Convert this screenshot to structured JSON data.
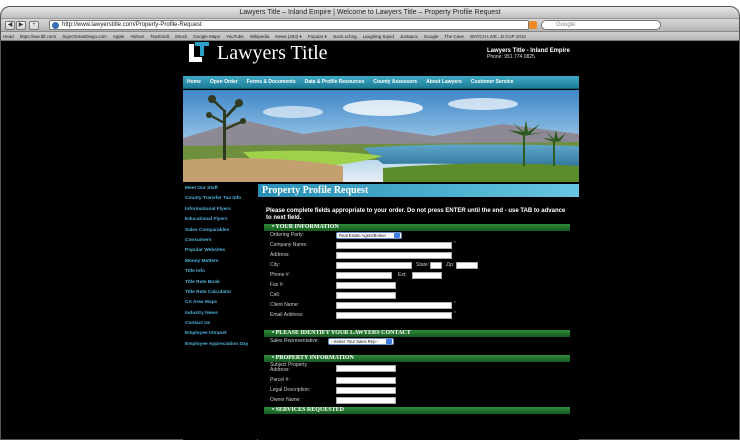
{
  "browser": {
    "window_title": "Lawyers Title – Inland Empire | Welcome to Lawyers Title – Property Profile Request",
    "url": "http://www.lawyerstitle.com/Property-Profile-Request",
    "search_placeholder": "Google",
    "bookmarks": [
      "Head",
      "https://ww.lttl.com/",
      "SignOnSanDiego.com",
      "Apple",
      "Yahoo!",
      "TeaSmidt",
      "iStock",
      "Google Maps",
      "YouTube",
      "Wikipedia",
      "News (263) ▾",
      "Popular ▾",
      "stock.xchng",
      "Laughing Squid",
      "Justapox",
      "Google",
      "The Cave",
      "WATCH LIVE...D CUP 2010"
    ]
  },
  "header": {
    "brand": "Lawyers Title",
    "office_name": "Lawyers Title - Inland Empire",
    "phone": "Phone: 951.774.0825"
  },
  "nav": [
    "Home",
    "Open Order",
    "Forms & Documents",
    "Data & Profile Resources",
    "County Assessors",
    "About Lawyers",
    "Customer Service"
  ],
  "sidebar": [
    "Meet Our Staff",
    "County Transfer Tax Info",
    "Informational Flyers",
    "Educational Flyers",
    "Sales Comparables",
    "Consumers",
    "Popular Websites",
    "Money Matters",
    "Title Info",
    "Title Rate Book",
    "Title Rate Calculator",
    "CA Area Maps",
    "Industry News",
    "Contact Us",
    "Employee Intranet",
    "Employee Appreciation Day"
  ],
  "form": {
    "title": "Property Profile Request",
    "instructions": "Please complete fields appropriate to your order. Do not press ENTER until the end - use TAB to advance to next field.",
    "section_your_info": "• YOUR INFORMATION",
    "ordering_party_label": "Ordering Party:",
    "ordering_party_value": "Real Estate Agent/Broker",
    "company_label": "Company Name:",
    "address_label": "Address:",
    "city_label": "City:",
    "state_label": "State:",
    "zip_label": "Zip:",
    "phone_label": "Phone #:",
    "ext_label": "Ext:",
    "fax_label": "Fax #:",
    "cell_label": "Cell:",
    "client_label": "Client Name:",
    "email_label": "Email Address:",
    "required_mark": "*",
    "section_contact": "• PLEASE IDENTIFY YOUR LAWYERS CONTACT",
    "sales_rep_label": "Sales Representative:",
    "sales_rep_value": "--Select Your Sales Rep--",
    "section_property": "• PROPERTY INFORMATION",
    "subject_label": "Subject Property Address:",
    "parcel_label": "Parcel #:",
    "legal_label": "Legal Description:",
    "owner_label": "Owner Name:",
    "section_services": "• SERVICES REQUESTED"
  },
  "colors": {
    "accent_blue": "#2a8fb5",
    "section_green": "#2f8a3a",
    "sidebar_link": "#4fb3d9"
  }
}
